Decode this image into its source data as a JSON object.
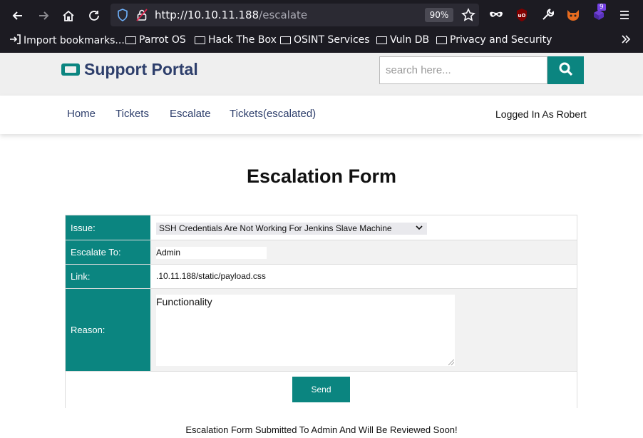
{
  "browser": {
    "url_host": "http://10.10.11.188",
    "url_path": "/escalate",
    "zoom": "90%",
    "badge_count": "9",
    "bookmarks": [
      "Import bookmarks...",
      "Parrot OS",
      "Hack The Box",
      "OSINT Services",
      "Vuln DB",
      "Privacy and Security"
    ],
    "icons": [
      "back-icon",
      "forward-icon",
      "home-icon",
      "reload-icon",
      "shield-icon",
      "lock-icon",
      "star-icon",
      "mask-icon",
      "ublock-icon",
      "wrench-icon",
      "fox-icon",
      "extension-icon",
      "menu-icon"
    ]
  },
  "site": {
    "logo": "Support Portal",
    "search_placeholder": "search here...",
    "nav": [
      "Home",
      "Tickets",
      "Escalate",
      "Tickets(escalated)"
    ],
    "user": "Logged In As Robert"
  },
  "form": {
    "title": "Escalation Form",
    "issue_label": "Issue:",
    "issue_value": "SSH Credentials Are Not Working For Jenkins Slave Machine",
    "escalate_label": "Escalate To:",
    "escalate_value": "Admin",
    "link_label": "Link:",
    "link_value": ".10.11.188/static/payload.css",
    "reason_label": "Reason:",
    "reason_value": "Functionality",
    "send_label": "Send"
  },
  "message": "Escalation Form Submitted To Admin And Will Be Reviewed Soon!",
  "colors": {
    "accent": "#0b8580",
    "brand_text": "#2d3e6b",
    "chrome_bg": "#1c1b22"
  }
}
